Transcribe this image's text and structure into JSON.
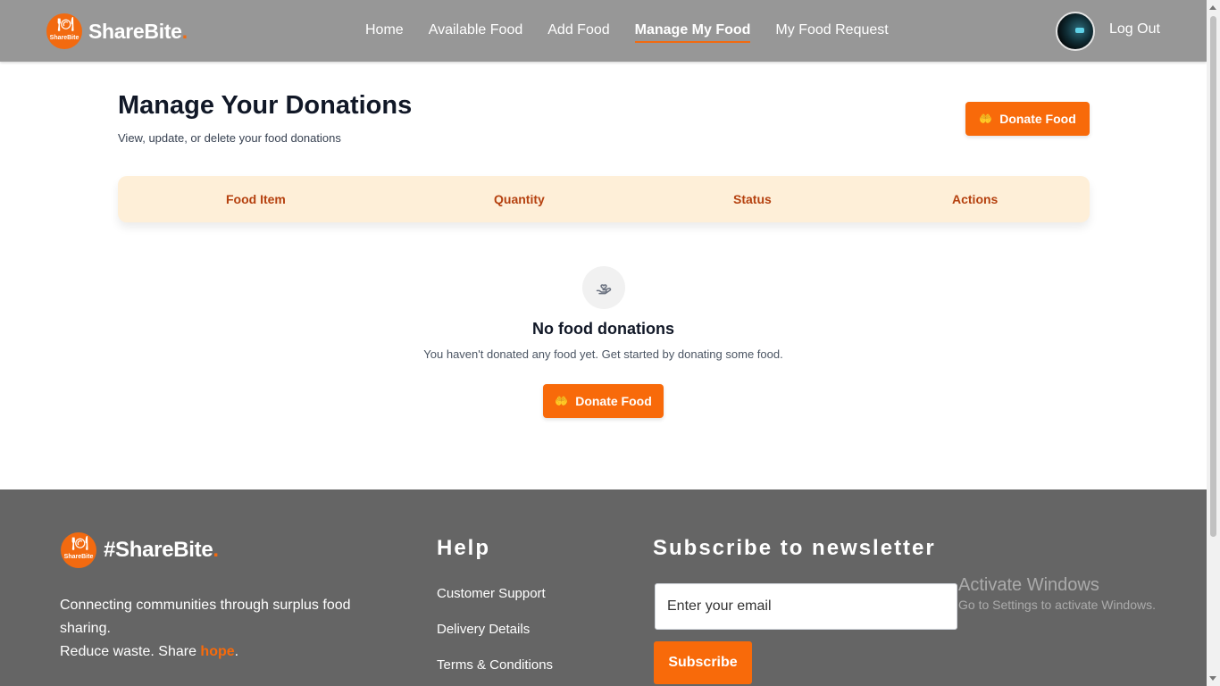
{
  "brand": {
    "name": "ShareBite",
    "dot": ".",
    "badge_text": "ShareBite",
    "icon": "fork-plate-icon"
  },
  "nav": {
    "items": [
      {
        "label": "Home",
        "active": false
      },
      {
        "label": "Available Food",
        "active": false
      },
      {
        "label": "Add Food",
        "active": false
      },
      {
        "label": "Manage My Food",
        "active": true
      },
      {
        "label": "My Food Request",
        "active": false
      }
    ],
    "logout": "Log Out"
  },
  "page": {
    "title": "Manage Your Donations",
    "subtitle": "View, update, or delete your food donations",
    "donate_button": "Donate Food"
  },
  "table": {
    "columns": [
      "Food Item",
      "Quantity",
      "Status",
      "Actions"
    ]
  },
  "empty_state": {
    "icon": "hand-heart-icon",
    "title": "No food donations",
    "text": "You haven't donated any food yet. Get started by donating some food.",
    "button": "Donate Food"
  },
  "footer": {
    "brand": "#ShareBite",
    "desc_line1": "Connecting communities through surplus food sharing.",
    "desc_line2_prefix": "Reduce waste. Share ",
    "desc_highlight": "hope",
    "desc_suffix": ".",
    "help_title": "Help",
    "help_links": [
      "Customer Support",
      "Delivery Details",
      "Terms & Conditions"
    ],
    "newsletter_title": "Subscribe to newsletter",
    "email_placeholder": "Enter your email",
    "subscribe_button": "Subscribe"
  },
  "watermark": {
    "title": "Activate Windows",
    "subtitle": "Go to Settings to activate Windows."
  },
  "colors": {
    "accent": "#f86a0a",
    "header_bg": "#979797",
    "footer_bg": "#656565",
    "table_head_bg": "#feefd8"
  }
}
